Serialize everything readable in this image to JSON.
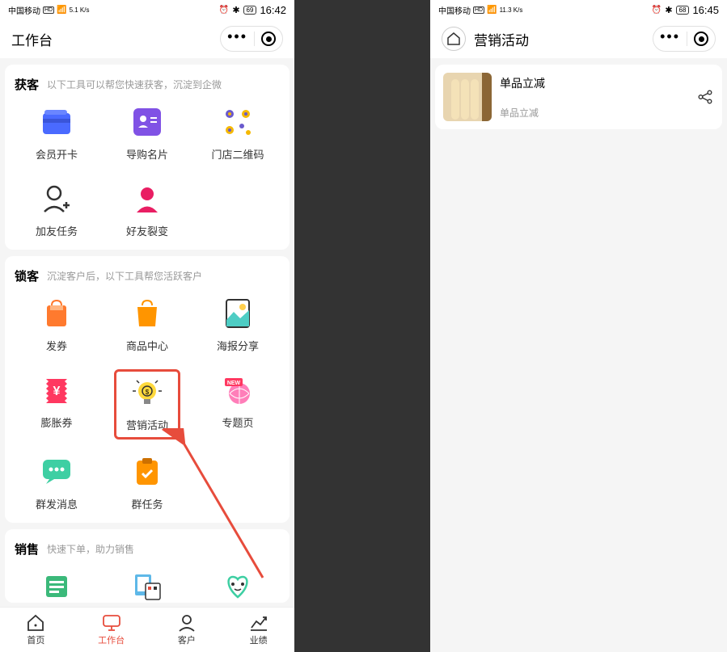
{
  "left": {
    "status": {
      "carrier": "中国移动",
      "speed": "5.1 K/s",
      "battery": "69",
      "time": "16:42"
    },
    "nav": {
      "title": "工作台"
    },
    "sections": {
      "customer_acquire": {
        "title": "获客",
        "subtitle": "以下工具可以帮您快速获客，沉淀到企微",
        "tools": [
          "会员开卡",
          "导购名片",
          "门店二维码",
          "加友任务",
          "好友裂变"
        ]
      },
      "customer_lock": {
        "title": "锁客",
        "subtitle": "沉淀客户后，以下工具帮您活跃客户",
        "tools": [
          "发券",
          "商品中心",
          "海报分享",
          "膨胀券",
          "营销活动",
          "专题页",
          "群发消息",
          "群任务"
        ]
      },
      "sales": {
        "title": "销售",
        "subtitle": "快速下单，助力销售"
      }
    },
    "bottomNav": [
      "首页",
      "工作台",
      "客户",
      "业绩"
    ]
  },
  "right": {
    "status": {
      "carrier": "中国移动",
      "speed": "11.3 K/s",
      "battery": "68",
      "time": "16:45"
    },
    "nav": {
      "title": "营销活动"
    },
    "activity": {
      "title": "单品立减",
      "desc": "单品立减"
    }
  }
}
